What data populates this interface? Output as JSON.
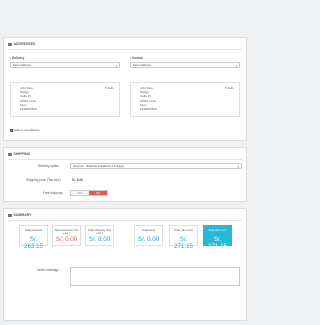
{
  "addresses": {
    "title": "ADDRESSES",
    "delivery": {
      "label": "Delivery",
      "selected": "Peru address",
      "edit_label": "Edit",
      "lines": [
        "John Doe",
        "Pedgo",
        "Calle 10",
        "07001 Lima",
        "Peru",
        "1234567890"
      ]
    },
    "invoice": {
      "label": "Invoice",
      "selected": "Peru address",
      "edit_label": "Edit",
      "lines": [
        "John Doe",
        "Pedgo",
        "Calle 10",
        "07001 Lima",
        "Peru",
        "1234567890"
      ]
    },
    "add_link": "Add a new address"
  },
  "shipping": {
    "title": "SHIPPING",
    "delivery_option_label": "Delivery option",
    "delivery_option_value": "Serpost - National standard (1-5 days)",
    "price_label": "Shipping price (Tax incl.)",
    "price_value": "S/. 8.00",
    "free_label": "Free shipping",
    "toggle_yes": "YES",
    "toggle_no": "NO"
  },
  "summary": {
    "title": "SUMMARY",
    "boxes": [
      {
        "label": "Total products",
        "value": "S/. 263.15",
        "color": "#2a9fd6"
      },
      {
        "label": "Total vouchers (Tax excl.)",
        "value": "S/. 0.00",
        "color": "#e15a5a"
      },
      {
        "label": "Total shipping (Tax excl.)",
        "value": "S/. 8.00",
        "color": "#2a9fd6"
      },
      {
        "label": "Total taxes",
        "value": "S/. 0.00",
        "color": "#2a9fd6"
      },
      {
        "label": "Total (Tax excl.)",
        "value": "S/. 271.15",
        "color": "#2a9fd6"
      },
      {
        "label": "Total (Tax incl.)",
        "value": "S/. 271.15",
        "color": "#ffffff"
      }
    ],
    "order_message_label": "Order message"
  }
}
